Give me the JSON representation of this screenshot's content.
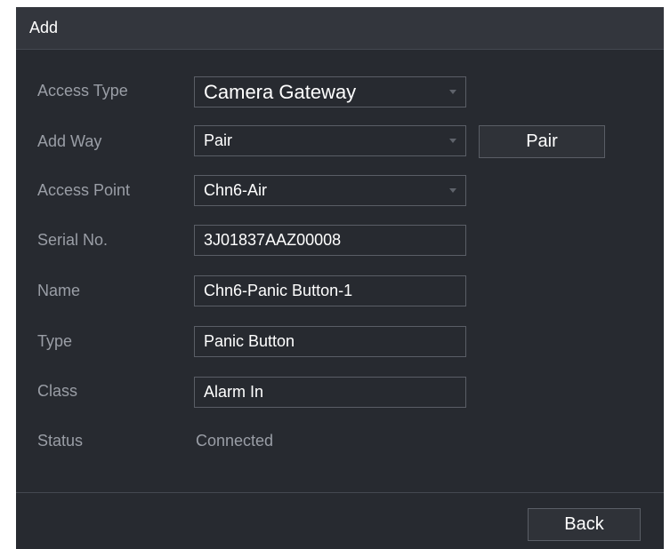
{
  "dialog": {
    "title": "Add"
  },
  "form": {
    "access_type": {
      "label": "Access Type",
      "value": "Camera Gateway"
    },
    "add_way": {
      "label": "Add Way",
      "value": "Pair",
      "pair_button": "Pair"
    },
    "access_point": {
      "label": "Access Point",
      "value": "Chn6-Air"
    },
    "serial_no": {
      "label": "Serial No.",
      "value": "3J01837AAZ00008"
    },
    "name": {
      "label": "Name",
      "value": "Chn6-Panic Button-1"
    },
    "type": {
      "label": "Type",
      "value": "Panic Button"
    },
    "class": {
      "label": "Class",
      "value": "Alarm In"
    },
    "status": {
      "label": "Status",
      "value": "Connected"
    }
  },
  "footer": {
    "back_label": "Back"
  }
}
